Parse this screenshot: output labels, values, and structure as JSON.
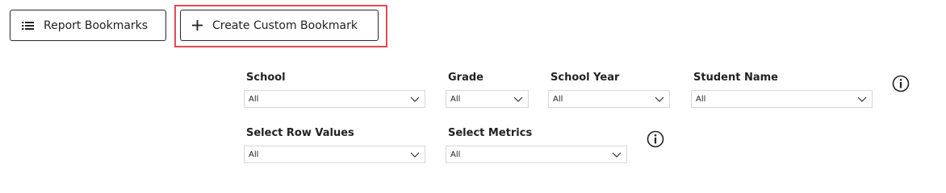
{
  "toolbar": {
    "report_bookmarks_label": "Report Bookmarks",
    "create_custom_bookmark_label": "Create Custom Bookmark",
    "highlight_color": "#e14b55"
  },
  "filters": {
    "school": {
      "label": "School",
      "value": "All"
    },
    "grade": {
      "label": "Grade",
      "value": "All"
    },
    "school_year": {
      "label": "School Year",
      "value": "All"
    },
    "student_name": {
      "label": "Student Name",
      "value": "All"
    },
    "select_row_values": {
      "label": "Select Row Values",
      "value": "All"
    },
    "select_metrics": {
      "label": "Select Metrics",
      "value": "All"
    }
  },
  "icons": {
    "report_bookmarks": "list-icon",
    "create_custom_bookmark": "plus-icon",
    "filter_info": "info-icon",
    "dropdown": "chevron-down-icon"
  }
}
